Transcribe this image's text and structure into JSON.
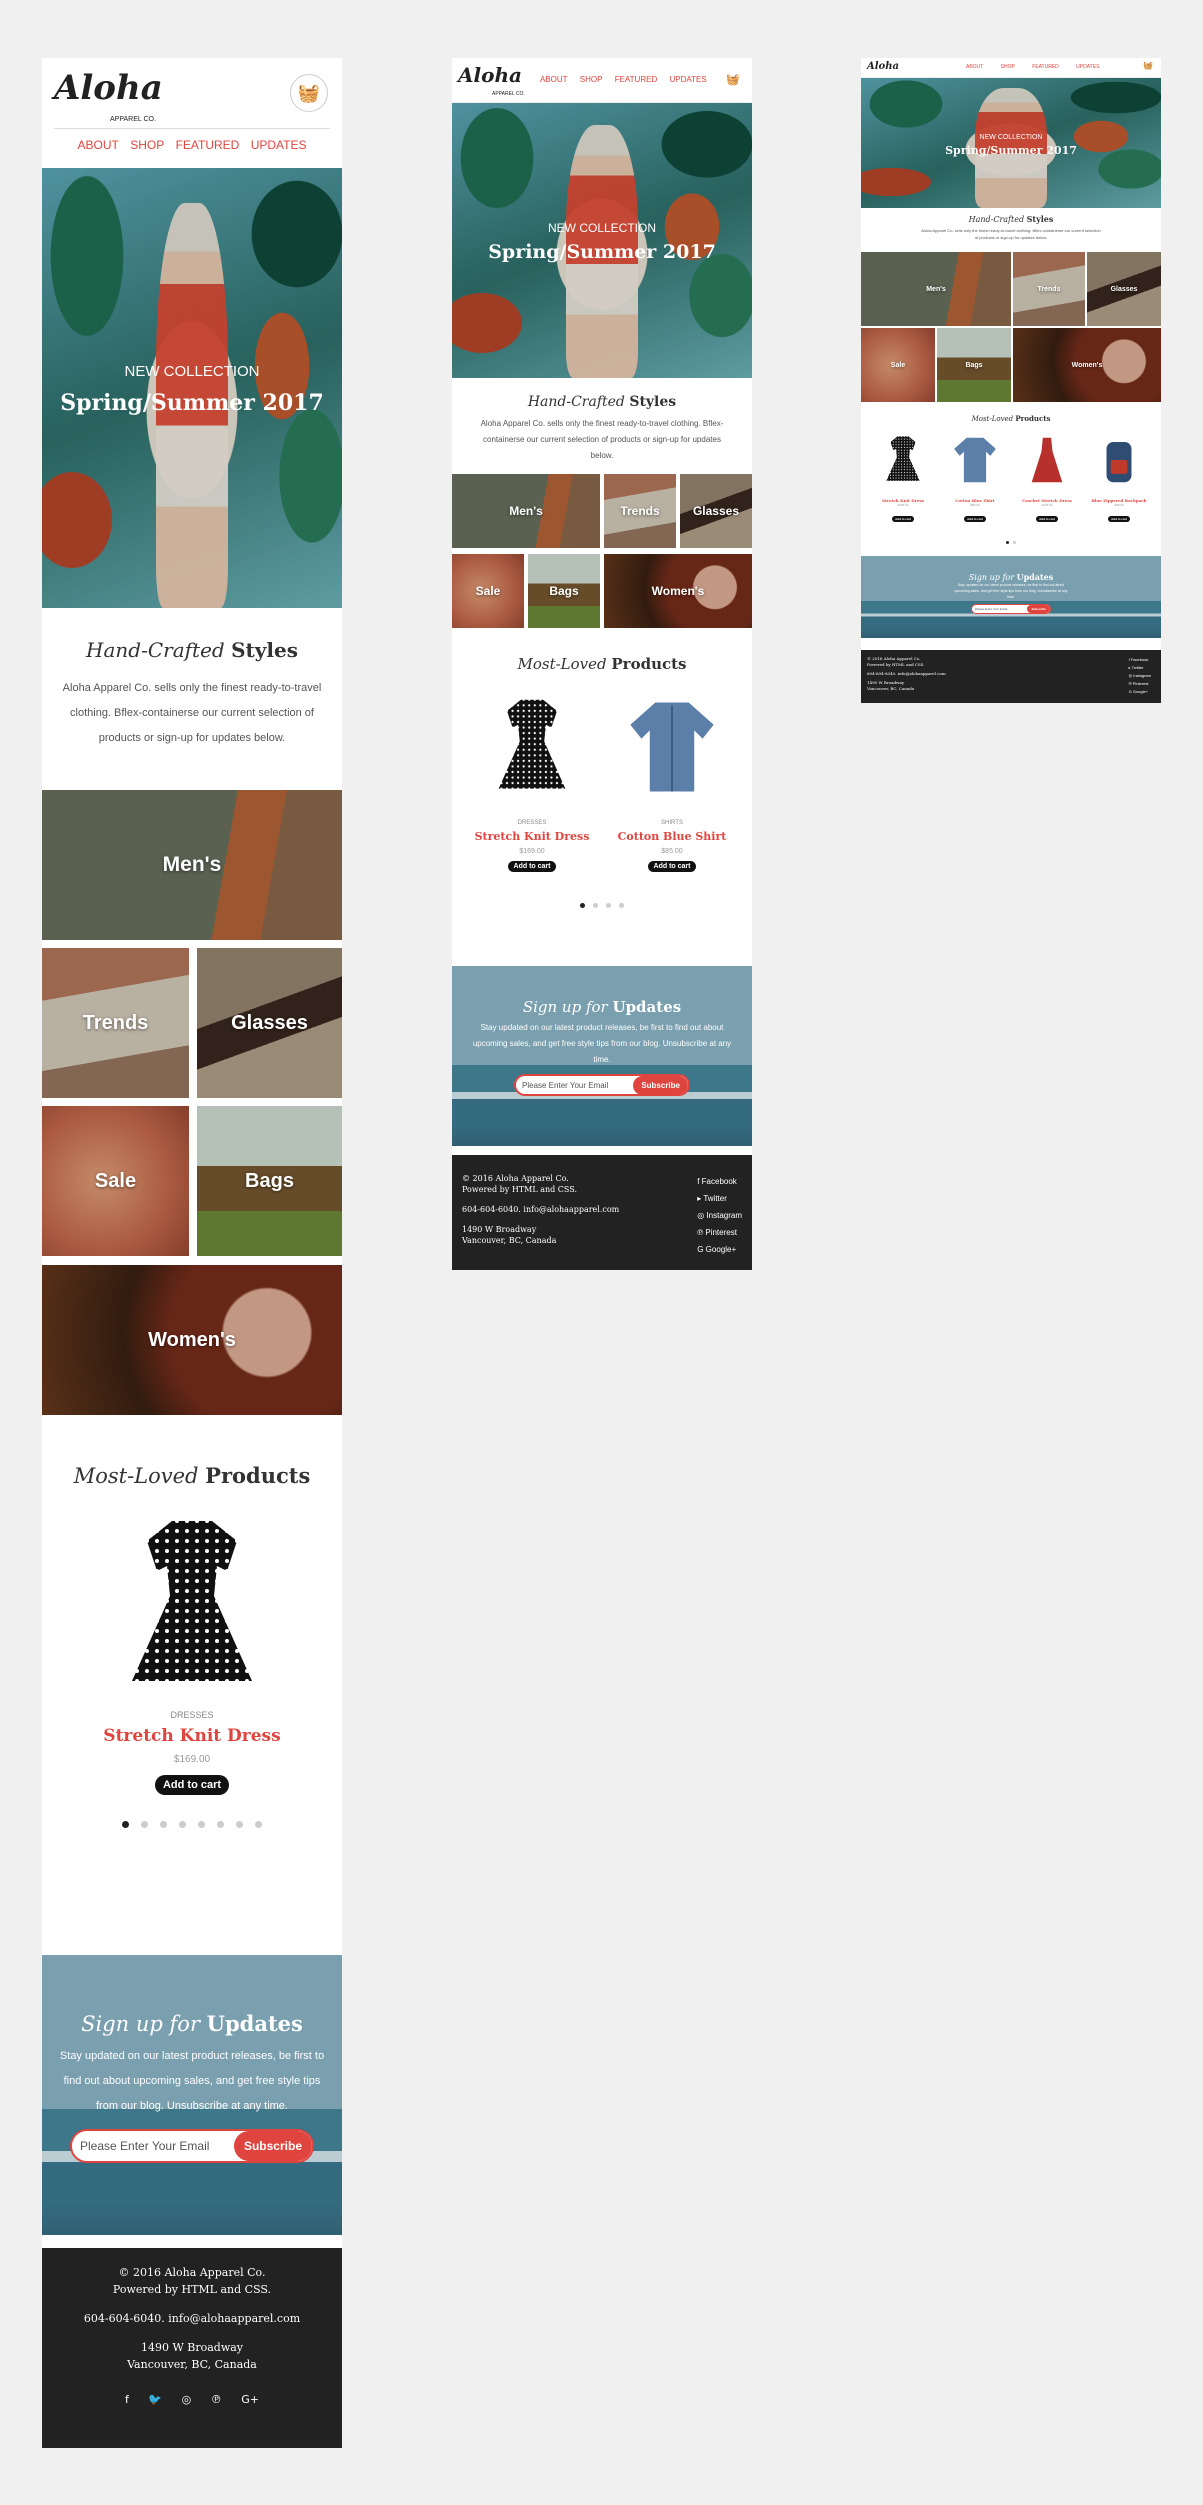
{
  "brand": {
    "name": "Aloha",
    "sub": "APPAREL CO."
  },
  "nav": [
    "ABOUT",
    "SHOP",
    "FEATURED",
    "UPDATES"
  ],
  "hero": {
    "kicker": "NEW COLLECTION",
    "title": "Spring/Summer 2017"
  },
  "intro": {
    "title_italic": "Hand-Crafted",
    "title_bold": "Styles",
    "text": "Aloha Apparel Co. sells only the finest ready-to-travel clothing. Bflex-containerse our current selection of products or sign-up for updates below."
  },
  "categories": [
    "Men's",
    "Trends",
    "Glasses",
    "Sale",
    "Bags",
    "Women's"
  ],
  "products": {
    "title_italic": "Most-Loved",
    "title_bold": "Products",
    "items": [
      {
        "category": "DRESSES",
        "name": "Stretch Knit Dress",
        "price": "$169.00",
        "cta": "Add to cart"
      },
      {
        "category": "SHIRTS",
        "name": "Cotton Blue Shirt",
        "price": "$85.00",
        "cta": "Add to cart"
      },
      {
        "category": "DRESSES",
        "name": "Crochet Stretch Dress",
        "price": "$129.00",
        "cta": "Add to cart"
      },
      {
        "category": "BAGS",
        "name": "Blue Zippered Backpack",
        "price": "$99.00",
        "cta": "Add to cart"
      }
    ]
  },
  "signup": {
    "title_italic": "Sign up for",
    "title_bold": "Updates",
    "text": "Stay updated on our latest product releases, be first to find out about upcoming sales, and get free style tips from our blog. Unsubscribe at any time.",
    "placeholder": "Please Enter Your Email",
    "button": "Subscribe"
  },
  "footer": {
    "copy": "© 2016 Aloha Apparel Co.",
    "powered": "Powered by HTML and CSS.",
    "contact": "604-604-6040. info@alohaapparel.com",
    "addr1": "1490 W Broadway",
    "addr2": "Vancouver, BC, Canada",
    "social": [
      "Facebook",
      "Twitter",
      "Instagram",
      "Pinterest",
      "Google+"
    ]
  },
  "colors": {
    "accent": "#e0443f",
    "footer": "#222222",
    "background": "#f0f0f0"
  }
}
